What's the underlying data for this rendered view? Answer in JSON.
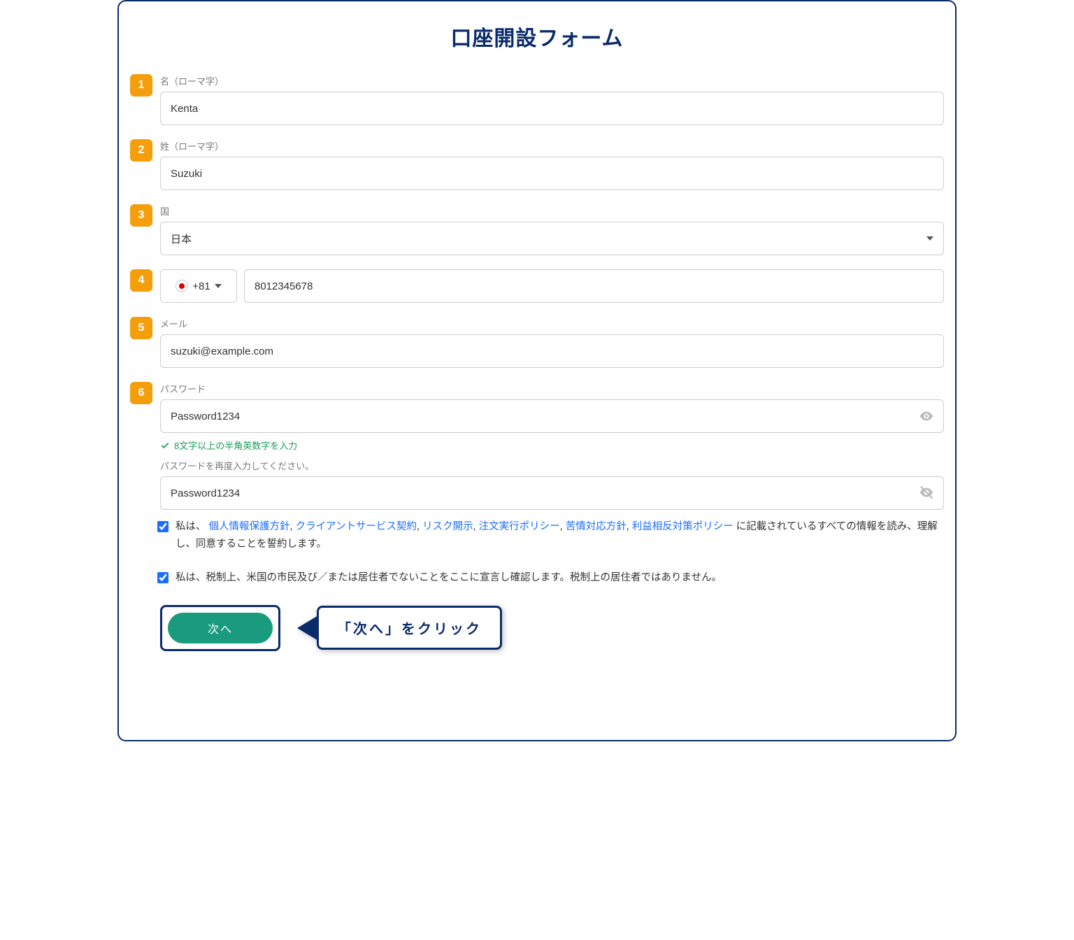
{
  "title": "口座開設フォーム",
  "steps": {
    "s1": {
      "num": "1",
      "label": "名（ローマ字）",
      "value": "Kenta"
    },
    "s2": {
      "num": "2",
      "label": "姓（ローマ字）",
      "value": "Suzuki"
    },
    "s3": {
      "num": "3",
      "label": "国",
      "value": "日本"
    },
    "s4": {
      "num": "4",
      "code": "+81",
      "phone": "8012345678"
    },
    "s5": {
      "num": "5",
      "label": "メール",
      "value": "suzuki@example.com"
    },
    "s6": {
      "num": "6",
      "label": "パスワード",
      "value": "Password1234"
    }
  },
  "hint_ok": "8文字以上の半角英数字を入力",
  "pw_repeat_label": "パスワードを再度入力してください。",
  "pw_repeat_value": "Password1234",
  "agree1": {
    "pre": "私は、",
    "links": {
      "l1": "個人情報保護方針",
      "l2": "クライアントサービス契約",
      "l3": "リスク開示",
      "l4": "注文実行ポリシー",
      "l5": "苦情対応方針",
      "l6": "利益相反対策ポリシー"
    },
    "post": " に記載されているすべての情報を読み、理解し、同意することを誓約します。"
  },
  "agree2": "私は、税制上、米国の市民及び／または居住者でないことをここに宣言し確認します。税制上の居住者ではありません。",
  "next_label": "次へ",
  "callout": "「次へ」をクリック"
}
